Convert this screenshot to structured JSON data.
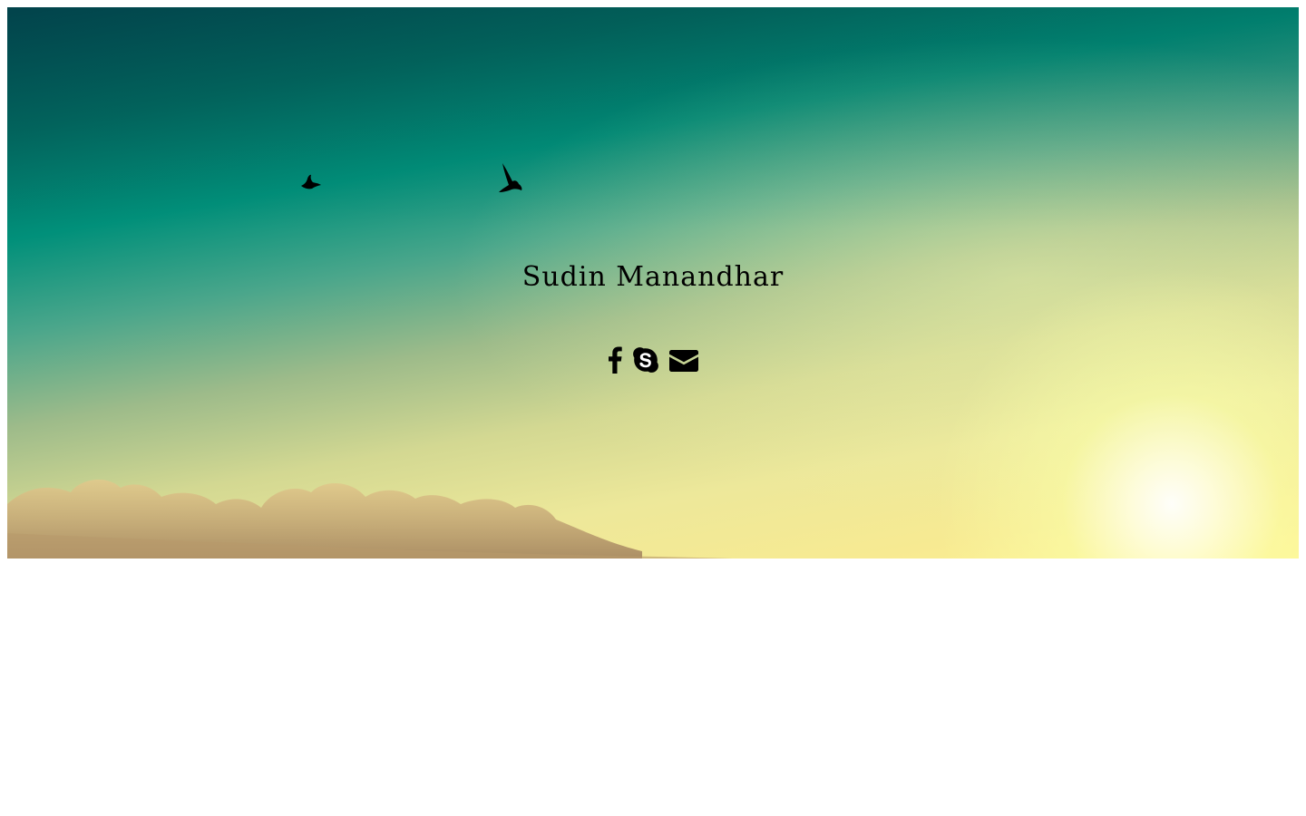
{
  "hero": {
    "title": "Sudin Manandhar",
    "background_colors": {
      "top": "#03424d",
      "middle": "#01907a",
      "bottom": "#fff28f",
      "sun": "#ffffe6"
    }
  },
  "social": {
    "items": [
      {
        "name": "facebook",
        "icon": "facebook-icon"
      },
      {
        "name": "skype",
        "icon": "skype-icon"
      },
      {
        "name": "email",
        "icon": "envelope-icon"
      }
    ],
    "icon_color": "#000000"
  }
}
